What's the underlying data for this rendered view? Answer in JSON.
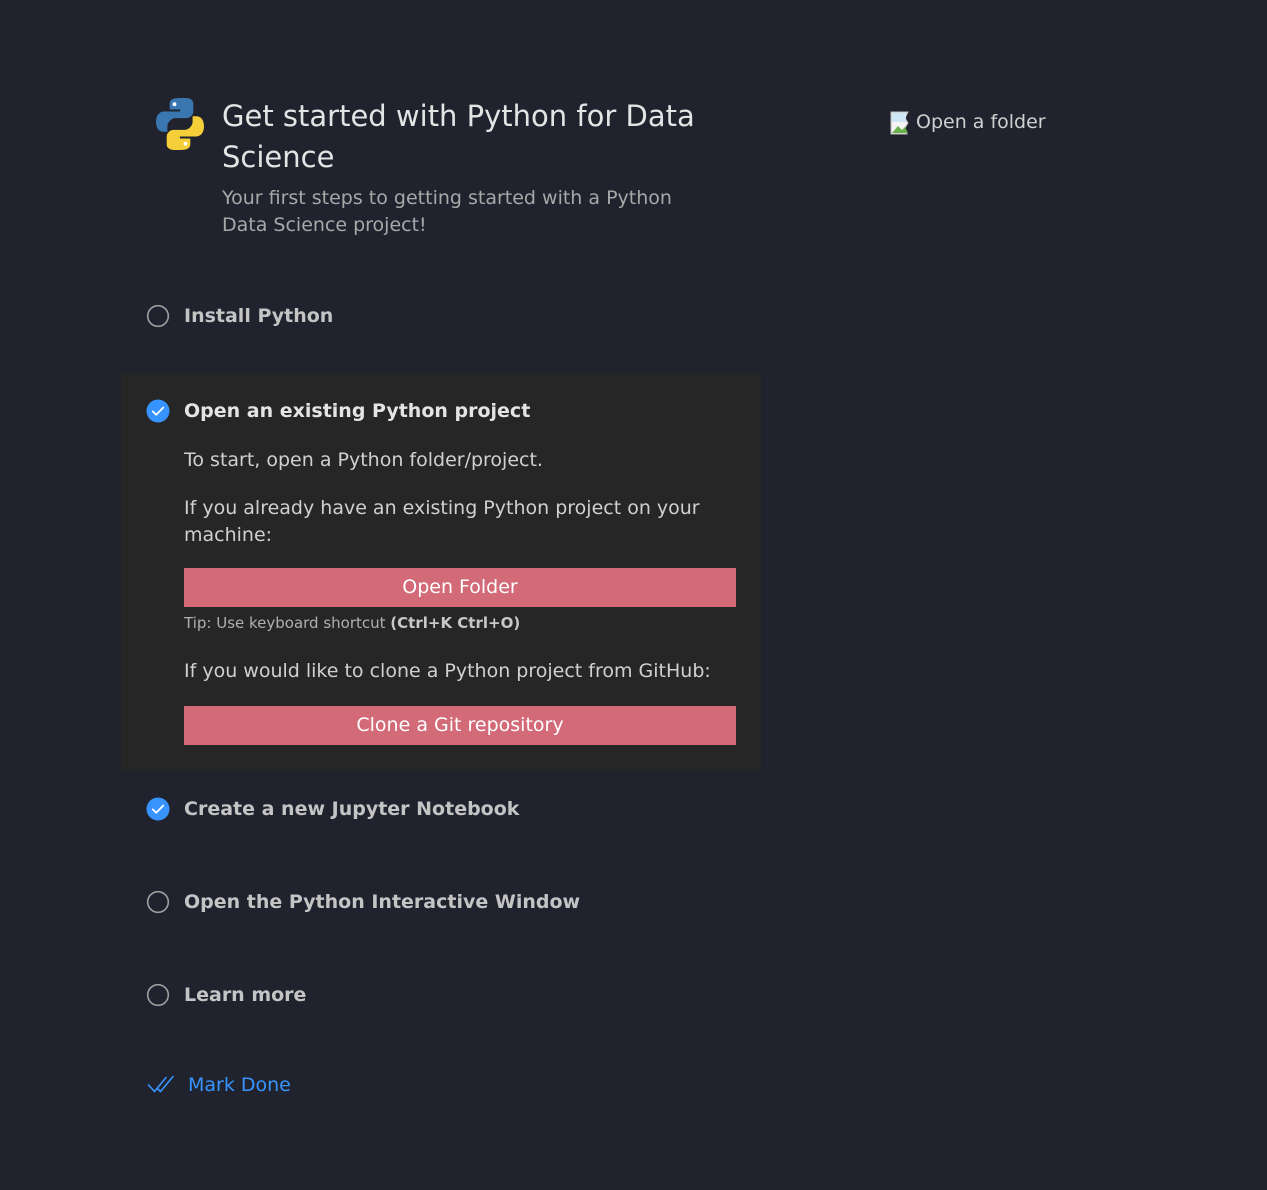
{
  "header": {
    "title": "Get started with Python for Data Science",
    "subtitle": "Your first steps to getting started with a Python Data Science project!"
  },
  "steps": [
    {
      "label": "Install Python",
      "checked": false
    },
    {
      "label": "Open an existing Python project",
      "checked": true,
      "body": {
        "p1": "To start, open a Python folder/project.",
        "p2": "If you already have an existing Python project on your machine:",
        "open_folder_button": "Open Folder",
        "tip_prefix": "Tip: Use keyboard shortcut ",
        "tip_shortcut": "(Ctrl+K Ctrl+O)",
        "p3": "If you would like to clone a Python project from GitHub:",
        "clone_button": "Clone a Git repository"
      }
    },
    {
      "label": "Create a new Jupyter Notebook",
      "checked": true
    },
    {
      "label": "Open the Python Interactive Window",
      "checked": false
    },
    {
      "label": "Learn more",
      "checked": false
    }
  ],
  "mark_done": {
    "label": "Mark Done",
    "icon": "check-all-icon"
  },
  "media": {
    "alt_text": "Open a folder"
  },
  "colors": {
    "background": "#20232e",
    "expanded_step_bg": "#262626",
    "button_bg": "#d26a78",
    "accent": "#3794ff"
  }
}
